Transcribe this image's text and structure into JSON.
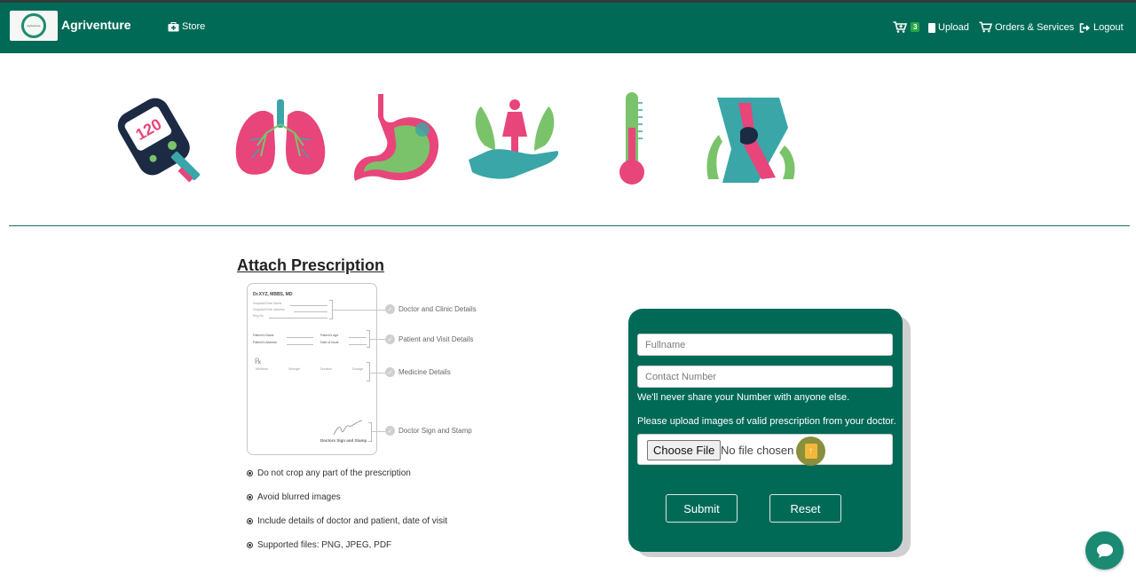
{
  "navbar": {
    "brand": "Agriventure",
    "logo_text": "agriventure",
    "store_label": "Store",
    "cart_count": "3",
    "upload_label": "Upload",
    "orders_label": "Orders & Services",
    "logout_label": "Logout"
  },
  "categories": [
    {
      "icon": "glucometer-icon"
    },
    {
      "icon": "lungs-icon"
    },
    {
      "icon": "stomach-icon"
    },
    {
      "icon": "womens-health-icon"
    },
    {
      "icon": "thermometer-icon"
    },
    {
      "icon": "knee-joint-icon"
    }
  ],
  "section": {
    "title": "Attach Prescription"
  },
  "sample_rx": {
    "doctor": "Dr.XYZ, MBBS, MD",
    "clinic_name": "Hospital/Clinic Name",
    "clinic_address": "Hospital/Clinic Address",
    "reg_no": "Reg No",
    "patient_name": "Patient's Name",
    "patient_age": "Patient's Age",
    "patient_address": "Patient's Address",
    "date_of_issue": "Date of Issue",
    "rx_symbol": "℞",
    "med_cols": [
      "Medicine",
      "Strength",
      "Duration",
      "Dosage"
    ],
    "sign_label": "Doctors Sign and Stamp",
    "callouts": [
      "Doctor and Clinic Details",
      "Patient and Visit Details",
      "Medicine Details",
      "Doctor Sign and Stamp"
    ]
  },
  "tips": [
    "Do not crop any part of the prescription",
    "Avoid blurred images",
    "Include details of doctor and patient, date of visit",
    "Supported files: PNG, JPEG, PDF"
  ],
  "form": {
    "fullname_placeholder": "Fullname",
    "contact_placeholder": "Contact Number",
    "privacy_note": "We'll never share your Number with anyone else.",
    "upload_note": "Please upload images of valid prescription from your doctor.",
    "choose_file_label": "Choose File",
    "no_file_text": "No file chosen",
    "submit_label": "Submit",
    "reset_label": "Reset"
  },
  "colors": {
    "primary": "#006a57",
    "accent_pink": "#e8457b",
    "accent_green": "#7ac36a",
    "accent_teal": "#3aa6a8"
  }
}
